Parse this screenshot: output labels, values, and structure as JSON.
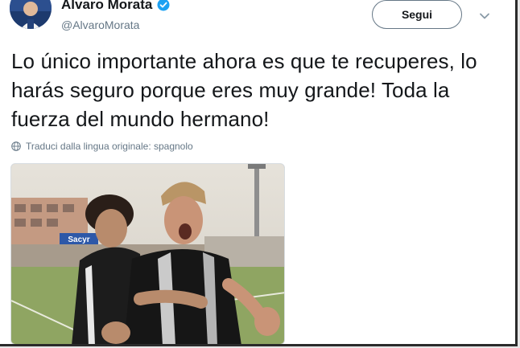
{
  "author": {
    "display_name": "Alvaro Morata",
    "handle": "@AlvaroMorata",
    "verified": true,
    "avatar_icon": "profile-photo"
  },
  "actions": {
    "follow_label": "Segui",
    "menu_icon": "chevron-down-icon"
  },
  "tweet": {
    "text": "Lo único importante ahora es que te recuperes, lo harás seguro porque eres muy grande! Toda la fuerza del mundo hermano!",
    "translate_label": "Traduci dalla lingua originale: spagnolo",
    "translate_icon": "globe-icon"
  },
  "media": {
    "type": "photo",
    "banner_text": "Sacyr"
  },
  "colors": {
    "text_primary": "#14171a",
    "text_secondary": "#657786",
    "verified_blue": "#1da1f2"
  }
}
